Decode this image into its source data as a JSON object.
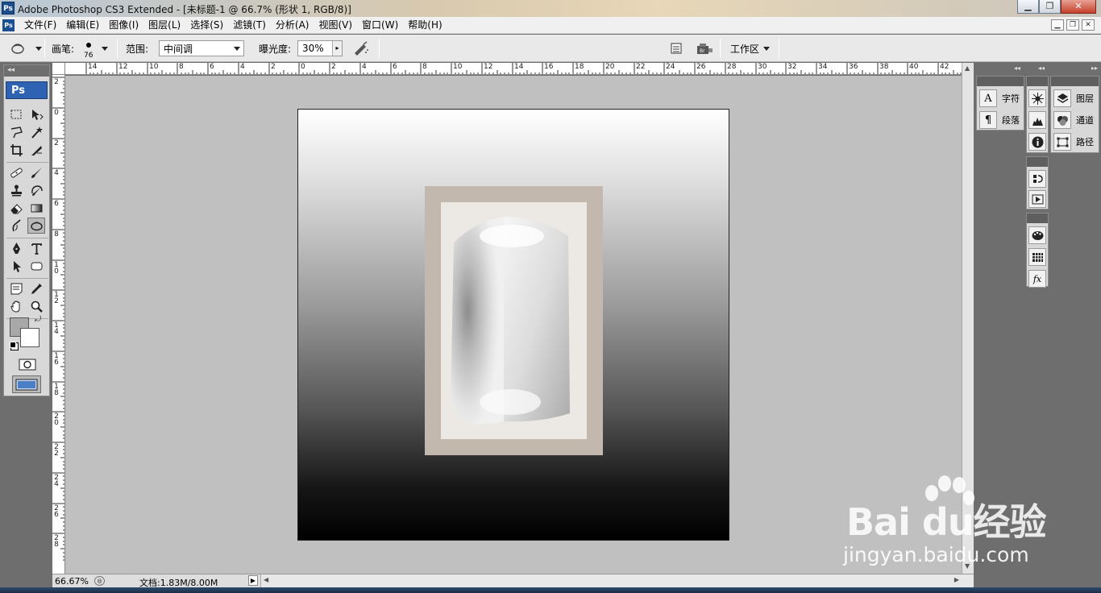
{
  "window": {
    "title": "Adobe Photoshop CS3 Extended - [未标题-1 @ 66.7% (形状 1, RGB/8)]",
    "app_icon": "Ps"
  },
  "menubar": {
    "items": [
      "文件(F)",
      "编辑(E)",
      "图像(I)",
      "图层(L)",
      "选择(S)",
      "滤镜(T)",
      "分析(A)",
      "视图(V)",
      "窗口(W)",
      "帮助(H)"
    ]
  },
  "options": {
    "brush_label": "画笔:",
    "brush_size": "76",
    "range_label": "范围:",
    "range_value": "中间调",
    "exposure_label": "曝光度:",
    "exposure_value": "30%",
    "workspace_label": "工作区"
  },
  "toolbox": {
    "logo": "Ps"
  },
  "ruler_top": {
    "labels": [
      "14",
      "12",
      "10",
      "8",
      "6",
      "4",
      "2",
      "0",
      "2",
      "4",
      "6",
      "8",
      "10",
      "12",
      "14",
      "16",
      "18",
      "20",
      "22",
      "24",
      "26",
      "28",
      "30",
      "32",
      "34",
      "36",
      "38",
      "40",
      "42"
    ]
  },
  "ruler_left": {
    "labels": [
      "2",
      "0",
      "2",
      "4",
      "6",
      "8",
      "10",
      "12",
      "14",
      "16",
      "18",
      "20",
      "22",
      "24",
      "26",
      "28"
    ]
  },
  "statusbar": {
    "zoom": "66.67%",
    "doc_info": "文档:1.83M/8.00M"
  },
  "panels": {
    "character": "字符",
    "paragraph": "段落",
    "layers": "图层",
    "channels": "通道",
    "paths": "路径"
  },
  "watermark": {
    "main": "Bai du经验",
    "sub": "jingyan.baidu.com"
  }
}
